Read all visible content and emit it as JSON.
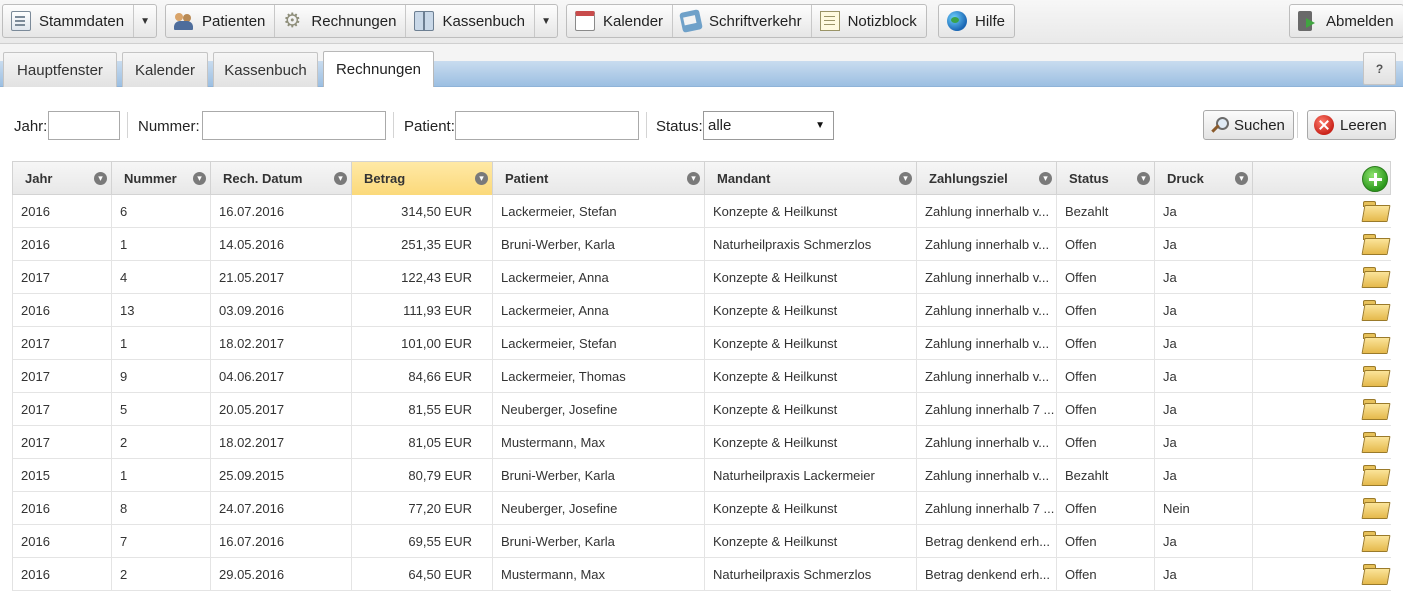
{
  "toolbar": {
    "stammdaten": "Stammdaten",
    "patienten": "Patienten",
    "rechnungen": "Rechnungen",
    "kassenbuch": "Kassenbuch",
    "kalender": "Kalender",
    "schriftverkehr": "Schriftverkehr",
    "notizblock": "Notizblock",
    "hilfe": "Hilfe",
    "abmelden": "Abmelden"
  },
  "tabs": [
    "Hauptfenster",
    "Kalender",
    "Kassenbuch",
    "Rechnungen"
  ],
  "active_tab": "Rechnungen",
  "help_label": "?",
  "filters": {
    "jahr_label": "Jahr:",
    "jahr_value": "",
    "nummer_label": "Nummer:",
    "nummer_value": "",
    "patient_label": "Patient:",
    "patient_value": "",
    "status_label": "Status:",
    "status_value": "alle"
  },
  "actions": {
    "search": "Suchen",
    "clear": "Leeren"
  },
  "table": {
    "columns": [
      "Jahr",
      "Nummer",
      "Rech. Datum",
      "Betrag",
      "Patient",
      "Mandant",
      "Zahlungsziel",
      "Status",
      "Druck"
    ],
    "sorted_column": "Betrag",
    "rows": [
      {
        "jahr": "2016",
        "nummer": "6",
        "datum": "16.07.2016",
        "betrag": "314,50 EUR",
        "patient": "Lackermeier, Stefan",
        "mandant": "Konzepte & Heilkunst",
        "zahlungsziel": "Zahlung innerhalb v...",
        "status": "Bezahlt",
        "druck": "Ja"
      },
      {
        "jahr": "2016",
        "nummer": "1",
        "datum": "14.05.2016",
        "betrag": "251,35 EUR",
        "patient": "Bruni-Werber, Karla",
        "mandant": "Naturheilpraxis Schmerzlos",
        "zahlungsziel": "Zahlung innerhalb v...",
        "status": "Offen",
        "druck": "Ja"
      },
      {
        "jahr": "2017",
        "nummer": "4",
        "datum": "21.05.2017",
        "betrag": "122,43 EUR",
        "patient": "Lackermeier, Anna",
        "mandant": "Konzepte & Heilkunst",
        "zahlungsziel": "Zahlung innerhalb v...",
        "status": "Offen",
        "druck": "Ja"
      },
      {
        "jahr": "2016",
        "nummer": "13",
        "datum": "03.09.2016",
        "betrag": "111,93 EUR",
        "patient": "Lackermeier, Anna",
        "mandant": "Konzepte & Heilkunst",
        "zahlungsziel": "Zahlung innerhalb v...",
        "status": "Offen",
        "druck": "Ja"
      },
      {
        "jahr": "2017",
        "nummer": "1",
        "datum": "18.02.2017",
        "betrag": "101,00 EUR",
        "patient": "Lackermeier, Stefan",
        "mandant": "Konzepte & Heilkunst",
        "zahlungsziel": "Zahlung innerhalb v...",
        "status": "Offen",
        "druck": "Ja"
      },
      {
        "jahr": "2017",
        "nummer": "9",
        "datum": "04.06.2017",
        "betrag": "84,66 EUR",
        "patient": "Lackermeier, Thomas",
        "mandant": "Konzepte & Heilkunst",
        "zahlungsziel": "Zahlung innerhalb v...",
        "status": "Offen",
        "druck": "Ja"
      },
      {
        "jahr": "2017",
        "nummer": "5",
        "datum": "20.05.2017",
        "betrag": "81,55 EUR",
        "patient": "Neuberger, Josefine",
        "mandant": "Konzepte & Heilkunst",
        "zahlungsziel": "Zahlung innerhalb 7 ...",
        "status": "Offen",
        "druck": "Ja"
      },
      {
        "jahr": "2017",
        "nummer": "2",
        "datum": "18.02.2017",
        "betrag": "81,05 EUR",
        "patient": "Mustermann, Max",
        "mandant": "Konzepte & Heilkunst",
        "zahlungsziel": "Zahlung innerhalb v...",
        "status": "Offen",
        "druck": "Ja"
      },
      {
        "jahr": "2015",
        "nummer": "1",
        "datum": "25.09.2015",
        "betrag": "80,79 EUR",
        "patient": "Bruni-Werber, Karla",
        "mandant": "Naturheilpraxis Lackermeier",
        "zahlungsziel": "Zahlung innerhalb v...",
        "status": "Bezahlt",
        "druck": "Ja"
      },
      {
        "jahr": "2016",
        "nummer": "8",
        "datum": "24.07.2016",
        "betrag": "77,20 EUR",
        "patient": "Neuberger, Josefine",
        "mandant": "Konzepte & Heilkunst",
        "zahlungsziel": "Zahlung innerhalb 7 ...",
        "status": "Offen",
        "druck": "Nein"
      },
      {
        "jahr": "2016",
        "nummer": "7",
        "datum": "16.07.2016",
        "betrag": "69,55 EUR",
        "patient": "Bruni-Werber, Karla",
        "mandant": "Konzepte & Heilkunst",
        "zahlungsziel": "Betrag denkend erh...",
        "status": "Offen",
        "druck": "Ja"
      },
      {
        "jahr": "2016",
        "nummer": "2",
        "datum": "29.05.2016",
        "betrag": "64,50 EUR",
        "patient": "Mustermann, Max",
        "mandant": "Naturheilpraxis Schmerzlos",
        "zahlungsziel": "Betrag denkend erh...",
        "status": "Offen",
        "druck": "Ja"
      }
    ]
  }
}
